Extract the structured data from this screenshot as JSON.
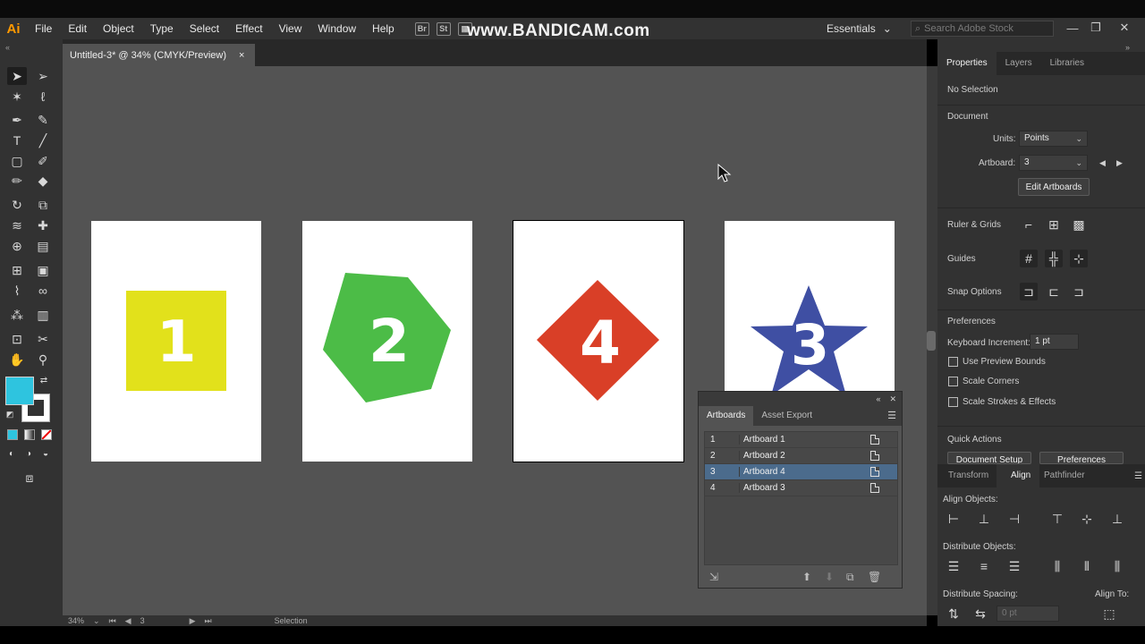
{
  "app": {
    "logo": "Ai",
    "watermark": "www.BANDICAM.com"
  },
  "menu": [
    "File",
    "Edit",
    "Object",
    "Type",
    "Select",
    "Effect",
    "View",
    "Window",
    "Help"
  ],
  "menubar_icons": [
    "Br",
    "St"
  ],
  "workspace": {
    "label": "Essentials"
  },
  "search": {
    "placeholder": "Search Adobe Stock"
  },
  "document_tab": {
    "title": "Untitled-3* @ 34% (CMYK/Preview)",
    "close": "×"
  },
  "artboards_canvas": [
    {
      "label": "1",
      "shape": "square",
      "color": "#e2e11b"
    },
    {
      "label": "2",
      "shape": "hexagon",
      "color": "#4cbc47"
    },
    {
      "label": "4",
      "shape": "diamond",
      "color": "#d93f27"
    },
    {
      "label": "3",
      "shape": "star",
      "color": "#3f4fa3"
    }
  ],
  "colors": {
    "fill": "#2ec4df",
    "stroke": "#ffffff"
  },
  "status_bar": {
    "zoom": "34%",
    "artboard": "3",
    "tool": "Selection"
  },
  "artboards_panel": {
    "tabs": [
      "Artboards",
      "Asset Export"
    ],
    "active_tab": "Artboards",
    "rows": [
      {
        "num": "1",
        "name": "Artboard 1",
        "selected": false
      },
      {
        "num": "2",
        "name": "Artboard 2",
        "selected": false
      },
      {
        "num": "3",
        "name": "Artboard 4",
        "selected": true
      },
      {
        "num": "4",
        "name": "Artboard 3",
        "selected": false
      }
    ]
  },
  "properties_panel": {
    "tabs": [
      "Properties",
      "Layers",
      "Libraries"
    ],
    "selection": "No Selection",
    "document_heading": "Document",
    "units_label": "Units:",
    "units_value": "Points",
    "artboard_label": "Artboard:",
    "artboard_value": "3",
    "edit_artboards": "Edit Artboards",
    "ruler_grids": "Ruler & Grids",
    "guides": "Guides",
    "snap_options": "Snap Options",
    "preferences_heading": "Preferences",
    "keyboard_increment_label": "Keyboard Increment:",
    "keyboard_increment_value": "1 pt",
    "checkboxes": [
      "Use Preview Bounds",
      "Scale Corners",
      "Scale Strokes & Effects"
    ],
    "quick_actions": "Quick Actions",
    "document_setup": "Document Setup",
    "preferences_btn": "Preferences"
  },
  "align_panel": {
    "tabs": [
      "Transform",
      "Align",
      "Pathfinder"
    ],
    "active_tab": "Align",
    "align_objects": "Align Objects:",
    "distribute_objects": "Distribute Objects:",
    "distribute_spacing": "Distribute Spacing:",
    "align_to": "Align To:",
    "spacing_value": "0 pt"
  }
}
